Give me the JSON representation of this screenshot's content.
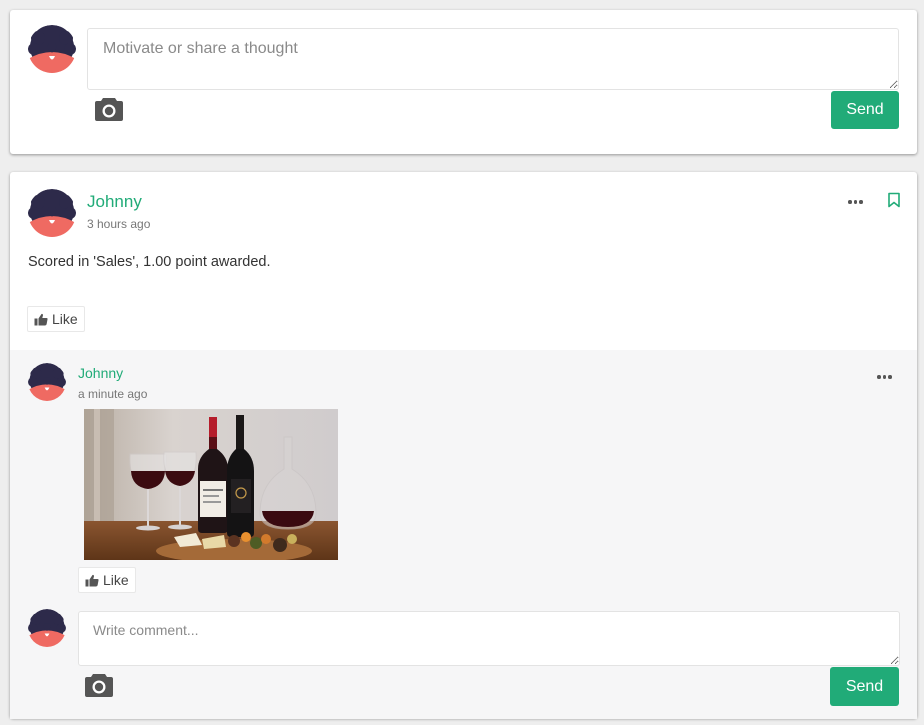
{
  "composer": {
    "placeholder": "Motivate or share a thought",
    "send_label": "Send"
  },
  "post": {
    "author": "Johnny",
    "time": "3 hours ago",
    "text": "Scored in 'Sales', 1.00 point awarded.",
    "like_label": "Like"
  },
  "comment": {
    "author": "Johnny",
    "time": "a minute ago",
    "like_label": "Like",
    "image_desc": "wine-bottles-photo"
  },
  "comment_composer": {
    "placeholder": "Write comment...",
    "send_label": "Send"
  },
  "colors": {
    "accent": "#21ab78",
    "avatar_bg": "#2d2a4a",
    "avatar_body": "#ef6a62"
  },
  "icons": [
    "camera-icon",
    "thumbs-up-icon",
    "more-options-icon",
    "bookmark-icon"
  ]
}
